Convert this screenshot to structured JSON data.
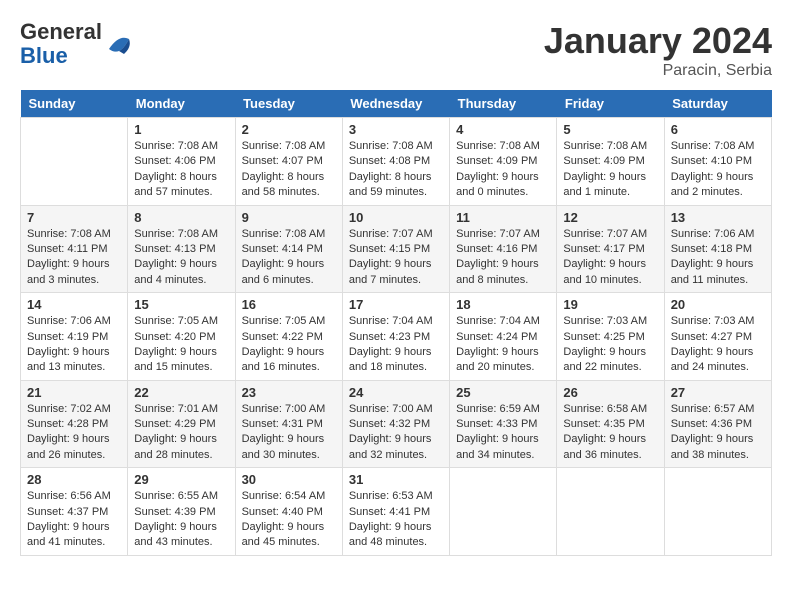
{
  "header": {
    "logo": {
      "general": "General",
      "blue": "Blue"
    },
    "title": "January 2024",
    "location": "Paracin, Serbia"
  },
  "columns": [
    "Sunday",
    "Monday",
    "Tuesday",
    "Wednesday",
    "Thursday",
    "Friday",
    "Saturday"
  ],
  "weeks": [
    [
      {
        "day": "",
        "sunrise": "",
        "sunset": "",
        "daylight": ""
      },
      {
        "day": "1",
        "sunrise": "Sunrise: 7:08 AM",
        "sunset": "Sunset: 4:06 PM",
        "daylight": "Daylight: 8 hours and 57 minutes."
      },
      {
        "day": "2",
        "sunrise": "Sunrise: 7:08 AM",
        "sunset": "Sunset: 4:07 PM",
        "daylight": "Daylight: 8 hours and 58 minutes."
      },
      {
        "day": "3",
        "sunrise": "Sunrise: 7:08 AM",
        "sunset": "Sunset: 4:08 PM",
        "daylight": "Daylight: 8 hours and 59 minutes."
      },
      {
        "day": "4",
        "sunrise": "Sunrise: 7:08 AM",
        "sunset": "Sunset: 4:09 PM",
        "daylight": "Daylight: 9 hours and 0 minutes."
      },
      {
        "day": "5",
        "sunrise": "Sunrise: 7:08 AM",
        "sunset": "Sunset: 4:09 PM",
        "daylight": "Daylight: 9 hours and 1 minute."
      },
      {
        "day": "6",
        "sunrise": "Sunrise: 7:08 AM",
        "sunset": "Sunset: 4:10 PM",
        "daylight": "Daylight: 9 hours and 2 minutes."
      }
    ],
    [
      {
        "day": "7",
        "sunrise": "Sunrise: 7:08 AM",
        "sunset": "Sunset: 4:11 PM",
        "daylight": "Daylight: 9 hours and 3 minutes."
      },
      {
        "day": "8",
        "sunrise": "Sunrise: 7:08 AM",
        "sunset": "Sunset: 4:13 PM",
        "daylight": "Daylight: 9 hours and 4 minutes."
      },
      {
        "day": "9",
        "sunrise": "Sunrise: 7:08 AM",
        "sunset": "Sunset: 4:14 PM",
        "daylight": "Daylight: 9 hours and 6 minutes."
      },
      {
        "day": "10",
        "sunrise": "Sunrise: 7:07 AM",
        "sunset": "Sunset: 4:15 PM",
        "daylight": "Daylight: 9 hours and 7 minutes."
      },
      {
        "day": "11",
        "sunrise": "Sunrise: 7:07 AM",
        "sunset": "Sunset: 4:16 PM",
        "daylight": "Daylight: 9 hours and 8 minutes."
      },
      {
        "day": "12",
        "sunrise": "Sunrise: 7:07 AM",
        "sunset": "Sunset: 4:17 PM",
        "daylight": "Daylight: 9 hours and 10 minutes."
      },
      {
        "day": "13",
        "sunrise": "Sunrise: 7:06 AM",
        "sunset": "Sunset: 4:18 PM",
        "daylight": "Daylight: 9 hours and 11 minutes."
      }
    ],
    [
      {
        "day": "14",
        "sunrise": "Sunrise: 7:06 AM",
        "sunset": "Sunset: 4:19 PM",
        "daylight": "Daylight: 9 hours and 13 minutes."
      },
      {
        "day": "15",
        "sunrise": "Sunrise: 7:05 AM",
        "sunset": "Sunset: 4:20 PM",
        "daylight": "Daylight: 9 hours and 15 minutes."
      },
      {
        "day": "16",
        "sunrise": "Sunrise: 7:05 AM",
        "sunset": "Sunset: 4:22 PM",
        "daylight": "Daylight: 9 hours and 16 minutes."
      },
      {
        "day": "17",
        "sunrise": "Sunrise: 7:04 AM",
        "sunset": "Sunset: 4:23 PM",
        "daylight": "Daylight: 9 hours and 18 minutes."
      },
      {
        "day": "18",
        "sunrise": "Sunrise: 7:04 AM",
        "sunset": "Sunset: 4:24 PM",
        "daylight": "Daylight: 9 hours and 20 minutes."
      },
      {
        "day": "19",
        "sunrise": "Sunrise: 7:03 AM",
        "sunset": "Sunset: 4:25 PM",
        "daylight": "Daylight: 9 hours and 22 minutes."
      },
      {
        "day": "20",
        "sunrise": "Sunrise: 7:03 AM",
        "sunset": "Sunset: 4:27 PM",
        "daylight": "Daylight: 9 hours and 24 minutes."
      }
    ],
    [
      {
        "day": "21",
        "sunrise": "Sunrise: 7:02 AM",
        "sunset": "Sunset: 4:28 PM",
        "daylight": "Daylight: 9 hours and 26 minutes."
      },
      {
        "day": "22",
        "sunrise": "Sunrise: 7:01 AM",
        "sunset": "Sunset: 4:29 PM",
        "daylight": "Daylight: 9 hours and 28 minutes."
      },
      {
        "day": "23",
        "sunrise": "Sunrise: 7:00 AM",
        "sunset": "Sunset: 4:31 PM",
        "daylight": "Daylight: 9 hours and 30 minutes."
      },
      {
        "day": "24",
        "sunrise": "Sunrise: 7:00 AM",
        "sunset": "Sunset: 4:32 PM",
        "daylight": "Daylight: 9 hours and 32 minutes."
      },
      {
        "day": "25",
        "sunrise": "Sunrise: 6:59 AM",
        "sunset": "Sunset: 4:33 PM",
        "daylight": "Daylight: 9 hours and 34 minutes."
      },
      {
        "day": "26",
        "sunrise": "Sunrise: 6:58 AM",
        "sunset": "Sunset: 4:35 PM",
        "daylight": "Daylight: 9 hours and 36 minutes."
      },
      {
        "day": "27",
        "sunrise": "Sunrise: 6:57 AM",
        "sunset": "Sunset: 4:36 PM",
        "daylight": "Daylight: 9 hours and 38 minutes."
      }
    ],
    [
      {
        "day": "28",
        "sunrise": "Sunrise: 6:56 AM",
        "sunset": "Sunset: 4:37 PM",
        "daylight": "Daylight: 9 hours and 41 minutes."
      },
      {
        "day": "29",
        "sunrise": "Sunrise: 6:55 AM",
        "sunset": "Sunset: 4:39 PM",
        "daylight": "Daylight: 9 hours and 43 minutes."
      },
      {
        "day": "30",
        "sunrise": "Sunrise: 6:54 AM",
        "sunset": "Sunset: 4:40 PM",
        "daylight": "Daylight: 9 hours and 45 minutes."
      },
      {
        "day": "31",
        "sunrise": "Sunrise: 6:53 AM",
        "sunset": "Sunset: 4:41 PM",
        "daylight": "Daylight: 9 hours and 48 minutes."
      },
      {
        "day": "",
        "sunrise": "",
        "sunset": "",
        "daylight": ""
      },
      {
        "day": "",
        "sunrise": "",
        "sunset": "",
        "daylight": ""
      },
      {
        "day": "",
        "sunrise": "",
        "sunset": "",
        "daylight": ""
      }
    ]
  ]
}
